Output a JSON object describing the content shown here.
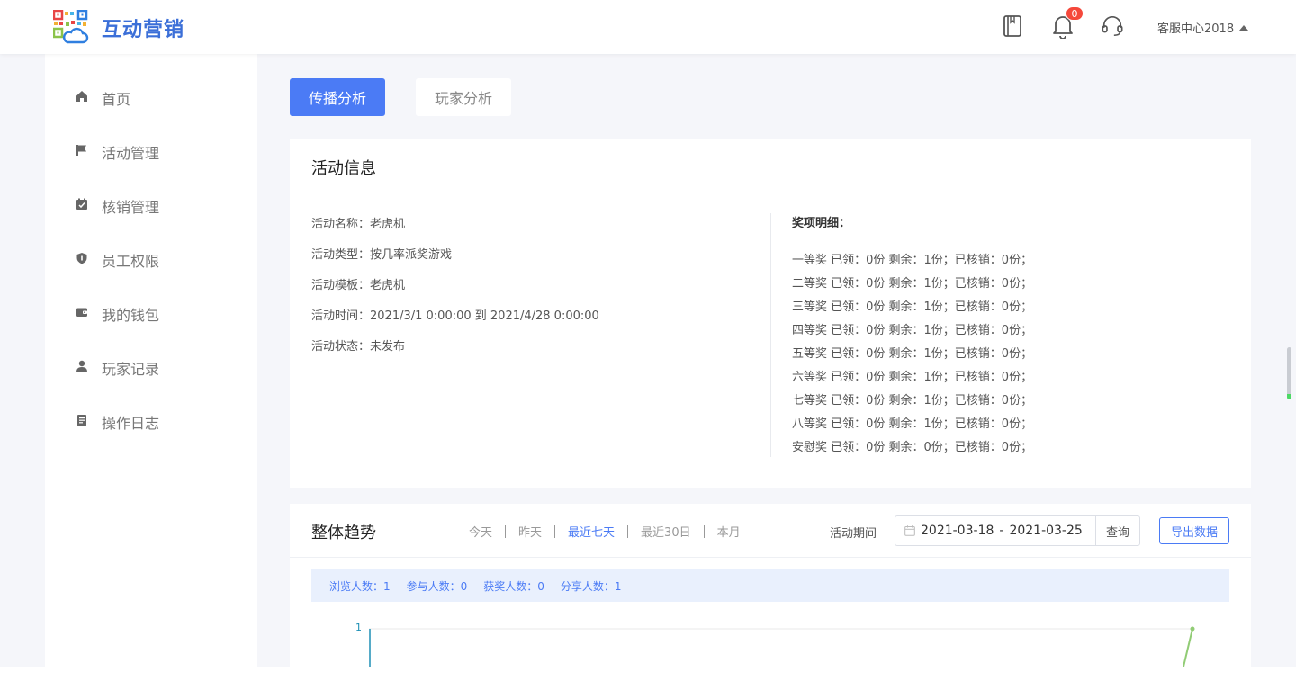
{
  "brand": {
    "name": "互动营销"
  },
  "header": {
    "notification_count": "0",
    "user_name": "客服中心2018"
  },
  "sidebar": {
    "items": [
      {
        "label": "首页",
        "icon": "home-icon"
      },
      {
        "label": "活动管理",
        "icon": "flag-icon"
      },
      {
        "label": "核销管理",
        "icon": "calendar-check-icon"
      },
      {
        "label": "员工权限",
        "icon": "shield-icon"
      },
      {
        "label": "我的钱包",
        "icon": "wallet-icon"
      },
      {
        "label": "玩家记录",
        "icon": "user-icon"
      },
      {
        "label": "操作日志",
        "icon": "document-icon"
      }
    ]
  },
  "tabs": [
    {
      "label": "传播分析",
      "active": true
    },
    {
      "label": "玩家分析",
      "active": false
    }
  ],
  "activity_info": {
    "title": "活动信息",
    "rows": [
      "活动名称：老虎机",
      "活动类型：按几率派奖游戏",
      "活动模板：老虎机",
      "活动时间：2021/3/1 0:00:00 到 2021/4/28 0:00:00",
      "活动状态：未发布"
    ],
    "prize_title": "奖项明细：",
    "prizes": [
      "一等奖 已领：0份 剩余：1份；已核销：0份；",
      "二等奖 已领：0份 剩余：1份；已核销：0份；",
      "三等奖 已领：0份 剩余：1份；已核销：0份；",
      "四等奖 已领：0份 剩余：1份；已核销：0份；",
      "五等奖 已领：0份 剩余：1份；已核销：0份；",
      "六等奖 已领：0份 剩余：1份；已核销：0份；",
      "七等奖 已领：0份 剩余：1份；已核销：0份；",
      "八等奖 已领：0份 剩余：1份；已核销：0份；",
      "安慰奖 已领：0份 剩余：0份；已核销：0份；"
    ]
  },
  "trend": {
    "title": "整体趋势",
    "range_options": [
      "今天",
      "昨天",
      "最近七天",
      "最近30日",
      "本月"
    ],
    "active_range": "最近七天",
    "period_label": "活动期间",
    "date_start": "2021-03-18",
    "date_sep": "-",
    "date_end": "2021-03-25",
    "query_label": "查询",
    "export_label": "导出数据",
    "stats": [
      "浏览人数：1",
      "参与人数：0",
      "获奖人数：0",
      "分享人数：1"
    ]
  },
  "chart_data": {
    "type": "line",
    "y_tick_labels": [
      "1"
    ],
    "ylim": [
      0,
      1
    ],
    "series": [
      {
        "values": [
          1
        ],
        "color": "#1d8fb5"
      },
      {
        "values": [
          1
        ],
        "color": "#91cc75"
      }
    ]
  },
  "colors": {
    "accent": "#4b7bf5",
    "brand": "#3b6fd8",
    "badge": "#f5483b"
  }
}
